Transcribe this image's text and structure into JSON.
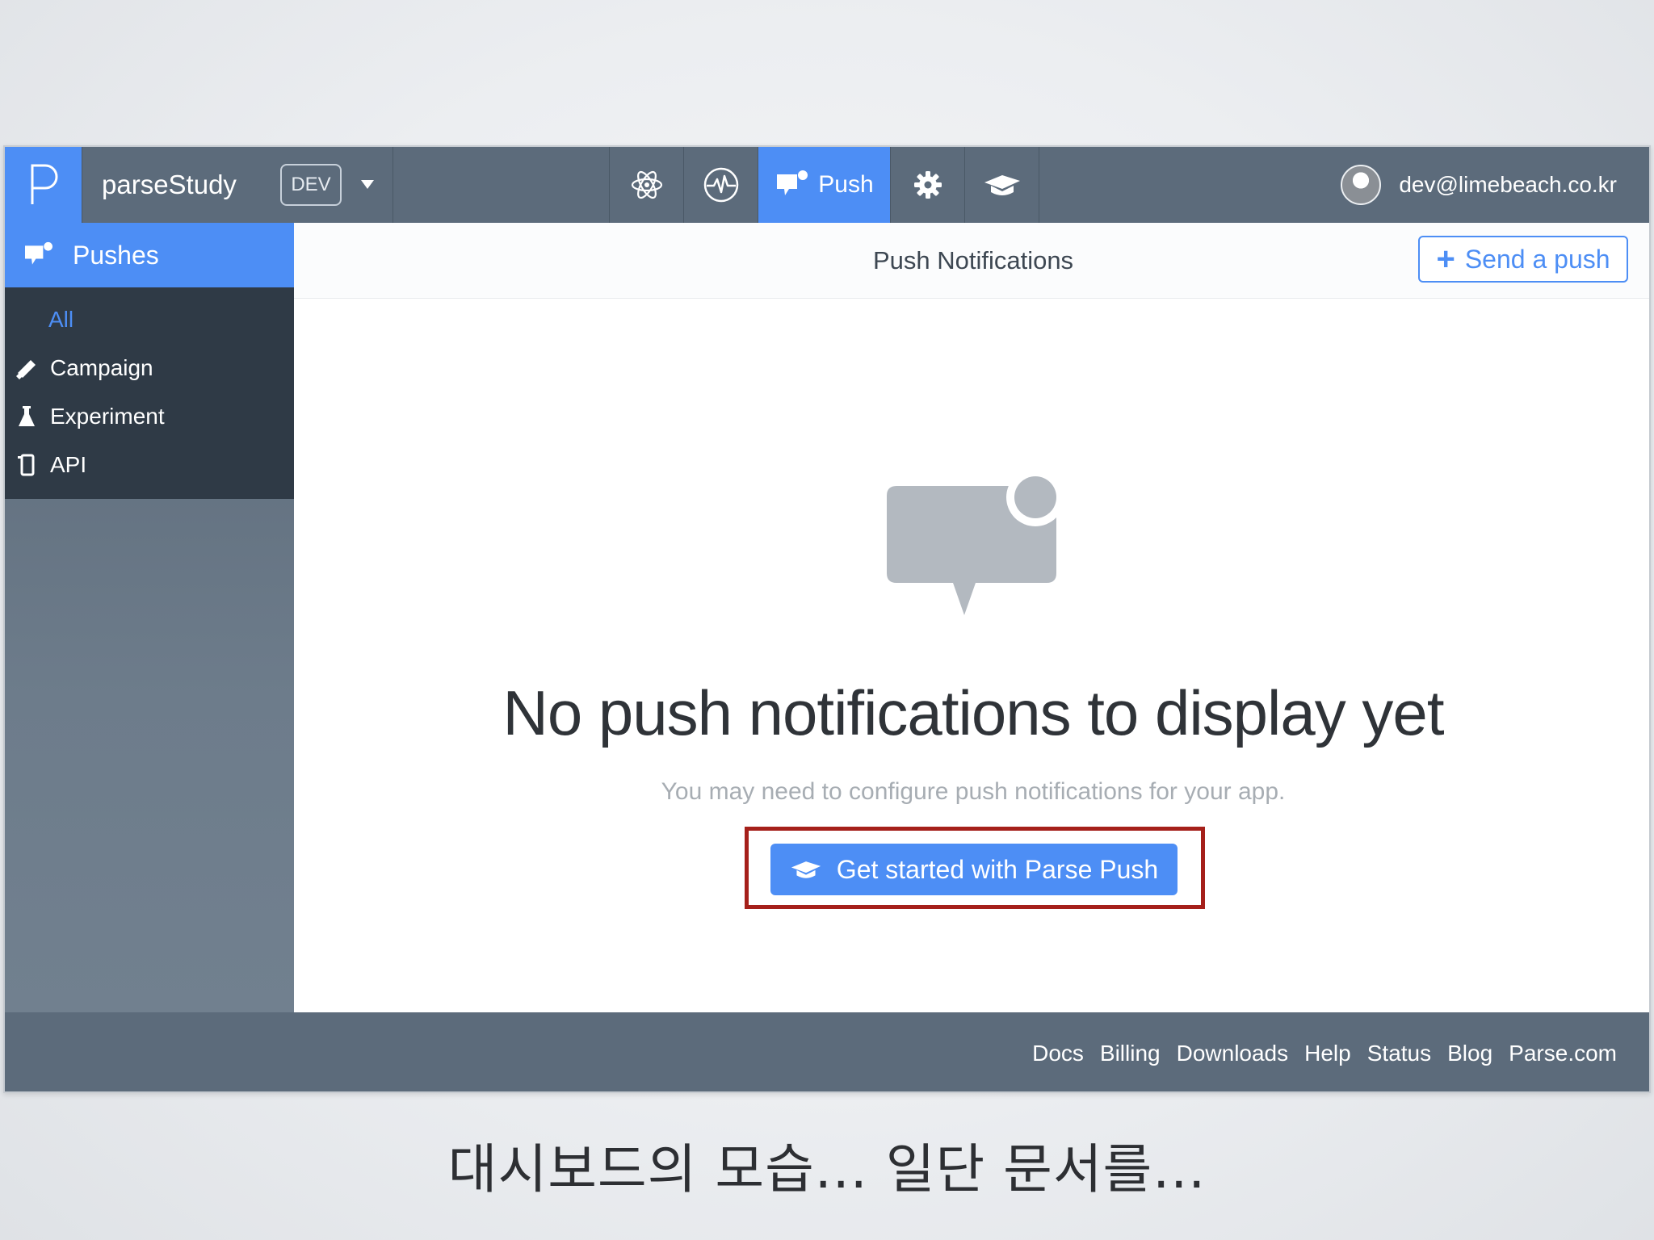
{
  "app": {
    "name": "parseStudy",
    "env": "DEV",
    "user_email": "dev@limebeach.co.kr"
  },
  "topnav": {
    "active_label": "Push",
    "items": [
      {
        "icon": "atom-icon"
      },
      {
        "icon": "analytics-pulse-icon"
      },
      {
        "icon": "push-chat-icon",
        "label": "Push"
      },
      {
        "icon": "gear-icon"
      },
      {
        "icon": "graduation-cap-icon"
      }
    ]
  },
  "sidebar": {
    "section_label": "Pushes",
    "items": [
      {
        "label": "All",
        "icon": ""
      },
      {
        "label": "Campaign",
        "icon": "megaphone-icon"
      },
      {
        "label": "Experiment",
        "icon": "flask-icon"
      },
      {
        "label": "API",
        "icon": "device-icon"
      }
    ]
  },
  "main": {
    "title": "Push Notifications",
    "send_button": "Send a push",
    "empty_title": "No push notifications to display yet",
    "empty_subtitle": "You may need to configure push notifications for your app.",
    "cta_button": "Get started with Parse Push"
  },
  "footer": {
    "links": [
      "Docs",
      "Billing",
      "Downloads",
      "Help",
      "Status",
      "Blog",
      "Parse.com"
    ]
  },
  "caption": "대시보드의 모습... 일단 문서를...",
  "colors": {
    "accent": "#4d8ef5",
    "topbar": "#5c6b7b",
    "sidebar_menu": "#2f3a46",
    "highlight": "#a5201a"
  }
}
